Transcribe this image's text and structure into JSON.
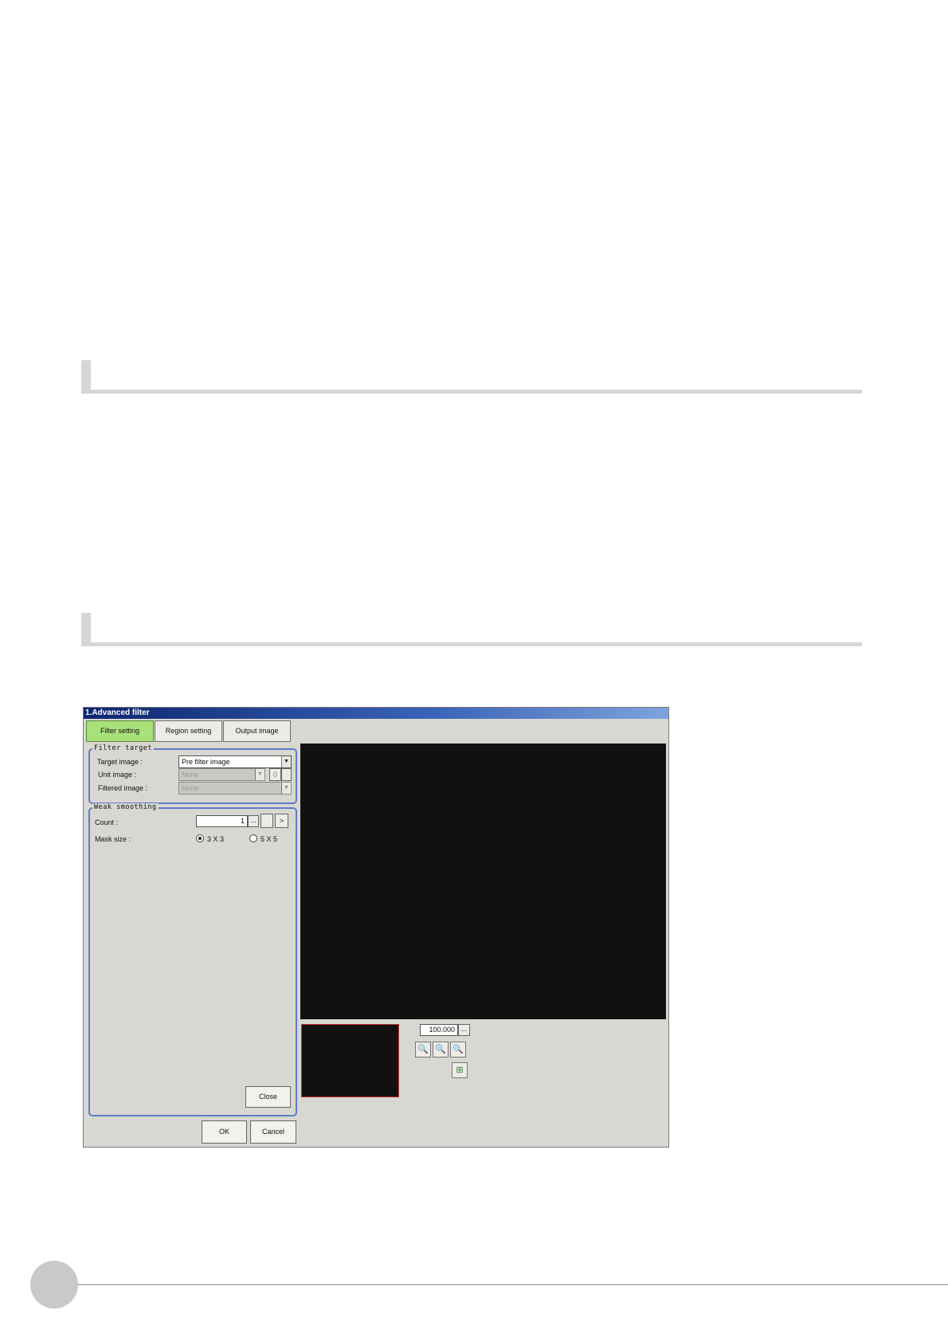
{
  "document": {
    "section_1": {
      "title": ""
    },
    "section_2": {
      "title": ""
    },
    "page_number": ""
  },
  "window": {
    "title": "1.Advanced filter",
    "tabs": [
      {
        "label": "Filter setting",
        "active": true
      },
      {
        "label": "Region setting",
        "active": false
      },
      {
        "label": "Output image",
        "active": false
      }
    ],
    "filter_target": {
      "legend": "Filter target",
      "target_image_label": "Target image :",
      "target_image_value": "Pre filter image",
      "unit_image_label": "Unit image :",
      "unit_image_value": "None",
      "unit_image_number": "0",
      "filtered_image_label": "Filtered image :",
      "filtered_image_value": "None"
    },
    "weak_smoothing": {
      "legend": "Weak smoothing",
      "count_label": "Count :",
      "count_value": "1",
      "ellipsis": "...",
      "next": ">",
      "mask_size_label": "Mask size :",
      "mask_options": [
        "3 X 3",
        "5 X 5"
      ],
      "mask_selected": "3 X 3",
      "close_label": "Close"
    },
    "ok_label": "OK",
    "cancel_label": "Cancel",
    "zoom_value": "100.000",
    "zoom_ellipsis": "...",
    "icons": [
      "zoom-in-icon",
      "zoom-out-icon",
      "zoom-fit-icon",
      "fit-to-window-icon"
    ],
    "accent_color": "#a8e07a",
    "group_border_color": "#5b7ec8"
  }
}
